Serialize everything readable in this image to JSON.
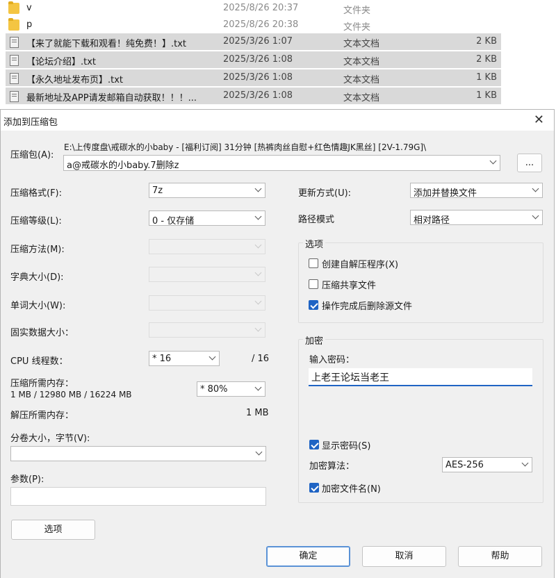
{
  "explorer": {
    "rows": [
      {
        "name": "v",
        "date": "2025/8/26 20:37",
        "type": "文件夹",
        "size": "",
        "icon": "folder-icon"
      },
      {
        "name": "p",
        "date": "2025/8/26 20:38",
        "type": "文件夹",
        "size": "",
        "icon": "folder-icon"
      },
      {
        "name": "【来了就能下载和观看！纯免费！】.txt",
        "date": "2025/3/26 1:07",
        "type": "文本文档",
        "size": "2 KB",
        "icon": "text-file-icon"
      },
      {
        "name": "【论坛介绍】.txt",
        "date": "2025/3/26 1:08",
        "type": "文本文档",
        "size": "2 KB",
        "icon": "text-file-icon"
      },
      {
        "name": "【永久地址发布页】.txt",
        "date": "2025/3/26 1:08",
        "type": "文本文档",
        "size": "1 KB",
        "icon": "text-file-icon"
      },
      {
        "name": "最新地址及APP请发邮箱自动获取！！！...",
        "date": "2025/3/26 1:08",
        "type": "文本文档",
        "size": "1 KB",
        "icon": "text-file-icon"
      }
    ]
  },
  "dialog": {
    "title": "添加到压缩包",
    "archive_label": "压缩包(A):",
    "archive_path": "E:\\上传度盘\\戒碳水的小baby - [福利订阅] 31分钟 [热裤肉丝自慰+红色情趣JK黑丝] [2V-1.79G]\\",
    "archive_name": "a@戒碳水的小baby.7删除z",
    "browse_label": "...",
    "format_label": "压缩格式(F):",
    "format_value": "7z",
    "level_label": "压缩等级(L):",
    "level_value": "0 - 仅存储",
    "method_label": "压缩方法(M):",
    "dict_label": "字典大小(D):",
    "word_label": "单词大小(W):",
    "solid_label": "固实数据大小：",
    "cpu_label": "CPU 线程数：",
    "cpu_value": "* 16",
    "cpu_max": "/ 16",
    "mem_label": "压缩所需内存：",
    "mem_detail": "1 MB / 12980 MB / 16224 MB",
    "mem_value": "* 80%",
    "decomp_label": "解压所需内存：",
    "decomp_value": "1 MB",
    "split_label": "分卷大小，字节(V):",
    "params_label": "参数(P):",
    "options_button": "选项",
    "update_label": "更新方式(U):",
    "update_value": "添加并替换文件",
    "path_label": "路径模式",
    "path_value": "相对路径",
    "options_group": "选项",
    "opt_sfx": "创建自解压程序(X)",
    "opt_shared": "压缩共享文件",
    "opt_delete": "操作完成后删除源文件",
    "encrypt_group": "加密",
    "password_label": "输入密码：",
    "password_value": "上老王论坛当老王",
    "show_password": "显示密码(S)",
    "enc_method_label": "加密算法：",
    "enc_method_value": "AES-256",
    "encrypt_names": "加密文件名(N)",
    "ok_button": "确定",
    "cancel_button": "取消",
    "help_button": "帮助",
    "checks": {
      "sfx": false,
      "shared": false,
      "delete": true,
      "show_password": true,
      "encrypt_names": true
    },
    "close_glyph": "✕"
  }
}
